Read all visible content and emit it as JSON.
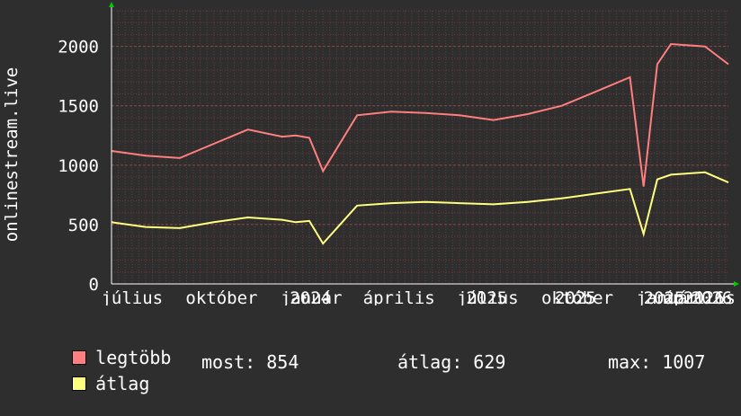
{
  "chart_data": {
    "type": "line",
    "title": "",
    "xlabel": "",
    "ylabel": "onlinestream.live",
    "ylim": [
      0,
      2300
    ],
    "xlim": [
      "2024-06-10",
      "2026-03-05"
    ],
    "yticks": [
      0,
      500,
      1000,
      1500,
      2000
    ],
    "xtick_labels": [
      "július",
      "október",
      "2024",
      "január",
      "április",
      "2025",
      "július",
      "2025",
      "október",
      "2025",
      "január",
      "április",
      "2026",
      "2026"
    ],
    "xtick_dates": [
      "2024-07-01",
      "2024-10-01",
      "2024-12-31",
      "2025-01-01",
      "2025-04-01",
      "2025-06-30",
      "2025-07-01",
      "2025-09-29",
      "2025-10-01",
      "2025-12-29",
      "2026-01-01",
      "2026-04-01",
      "2026-03-01",
      "2026-03-09"
    ],
    "grid": true,
    "legend_position": "bottom",
    "series": [
      {
        "name": "legtöbb",
        "color": "#ff7f7f",
        "x": [
          "2024-06-10",
          "2024-07-15",
          "2024-08-19",
          "2024-09-23",
          "2024-10-28",
          "2024-12-02",
          "2024-12-16",
          "2024-12-30",
          "2025-01-13",
          "2025-02-17",
          "2025-03-24",
          "2025-04-28",
          "2025-06-02",
          "2025-07-07",
          "2025-08-11",
          "2025-09-15",
          "2025-10-20",
          "2025-11-24",
          "2025-12-08",
          "2025-12-22",
          "2026-01-05",
          "2026-02-09",
          "2026-03-05"
        ],
        "y": [
          1120,
          1080,
          1060,
          1180,
          1300,
          1240,
          1250,
          1230,
          950,
          1420,
          1450,
          1440,
          1420,
          1380,
          1430,
          1500,
          1620,
          1740,
          820,
          1850,
          2020,
          2000,
          1850
        ]
      },
      {
        "name": "átlag",
        "color": "#ffff80",
        "x": [
          "2024-06-10",
          "2024-07-15",
          "2024-08-19",
          "2024-09-23",
          "2024-10-28",
          "2024-12-02",
          "2024-12-16",
          "2024-12-30",
          "2025-01-13",
          "2025-02-17",
          "2025-03-24",
          "2025-04-28",
          "2025-06-02",
          "2025-07-07",
          "2025-08-11",
          "2025-09-15",
          "2025-10-20",
          "2025-11-24",
          "2025-12-08",
          "2025-12-22",
          "2026-01-05",
          "2026-02-09",
          "2026-03-05"
        ],
        "y": [
          520,
          480,
          470,
          520,
          560,
          540,
          520,
          530,
          340,
          660,
          680,
          690,
          680,
          670,
          690,
          720,
          760,
          800,
          420,
          880,
          920,
          940,
          854
        ]
      }
    ]
  },
  "legend": {
    "max_label": "legtöbb",
    "avg_label": "átlag"
  },
  "stats": {
    "current": "most: 854",
    "average": "átlag: 629",
    "maximum": "max: 1007"
  },
  "colors": {
    "background": "#2e2e2e",
    "plot_background": "#2e2e2e",
    "grid": "#6a3a3a",
    "axis": "#ffffff",
    "arrow": "#00cc00"
  }
}
